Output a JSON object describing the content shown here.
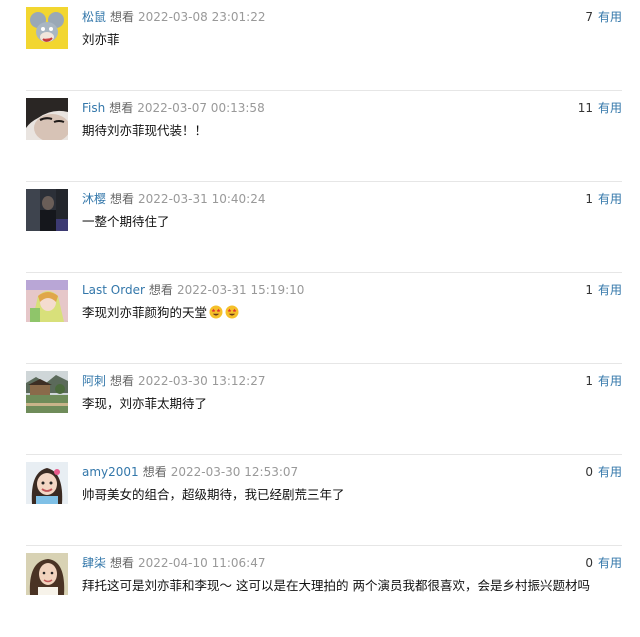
{
  "comments": [
    {
      "user": "松鼠",
      "action": "想看",
      "time": "2022-03-08 23:01:22",
      "votes": "7",
      "vote_label": "有用",
      "text": "刘亦菲",
      "avatar_icon": "cartoon-mouse-avatar"
    },
    {
      "user": "Fish",
      "action": "想看",
      "time": "2022-03-07 00:13:58",
      "votes": "11",
      "vote_label": "有用",
      "text": "期待刘亦菲现代装！！",
      "avatar_icon": "face-closeup-avatar"
    },
    {
      "user": "沐樱",
      "action": "想看",
      "time": "2022-03-31 10:40:24",
      "votes": "1",
      "vote_label": "有用",
      "text": "一整个期待住了",
      "avatar_icon": "dark-portrait-avatar"
    },
    {
      "user": "Last Order",
      "action": "想看",
      "time": "2022-03-31 15:19:10",
      "votes": "1",
      "vote_label": "有用",
      "text": "李现刘亦菲颜狗的天堂",
      "emojis": [
        "star-struck-emoji",
        "star-struck-emoji"
      ],
      "avatar_icon": "anime-avatar"
    },
    {
      "user": "阿刺",
      "action": "想看",
      "time": "2022-03-30 13:12:27",
      "votes": "1",
      "vote_label": "有用",
      "text": "李现，刘亦菲太期待了",
      "avatar_icon": "landscape-avatar"
    },
    {
      "user": "amy2001",
      "action": "想看",
      "time": "2022-03-30 12:53:07",
      "votes": "0",
      "vote_label": "有用",
      "text": "帅哥美女的组合，超级期待，我已经剧荒三年了",
      "avatar_icon": "child-portrait-avatar"
    },
    {
      "user": "肆柒",
      "action": "想看",
      "time": "2022-04-10 11:06:47",
      "votes": "0",
      "vote_label": "有用",
      "text": "拜托这可是刘亦菲和李现～ 这可以是在大理拍的 两个演员我都很喜欢，会是乡村振兴题材吗",
      "avatar_icon": "woman-portrait-avatar"
    }
  ]
}
